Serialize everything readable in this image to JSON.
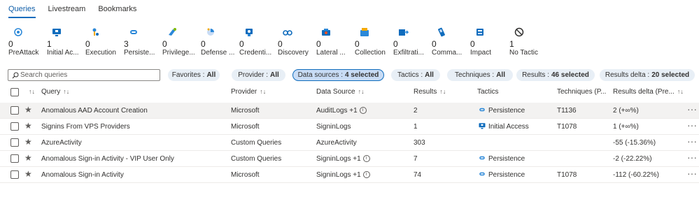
{
  "tabs": [
    {
      "label": "Queries",
      "active": true
    },
    {
      "label": "Livestream",
      "active": false
    },
    {
      "label": "Bookmarks",
      "active": false
    }
  ],
  "tactics": [
    {
      "icon": "preattack-icon",
      "count": "0",
      "name": "PreAttack"
    },
    {
      "icon": "initial-access-icon",
      "count": "1",
      "name": "Initial Ac..."
    },
    {
      "icon": "execution-icon",
      "count": "0",
      "name": "Execution"
    },
    {
      "icon": "persistence-icon",
      "count": "3",
      "name": "Persiste..."
    },
    {
      "icon": "privilege-escalation-icon",
      "count": "0",
      "name": "Privilege..."
    },
    {
      "icon": "defense-evasion-icon",
      "count": "0",
      "name": "Defense ..."
    },
    {
      "icon": "credential-access-icon",
      "count": "0",
      "name": "Credenti..."
    },
    {
      "icon": "discovery-icon",
      "count": "0",
      "name": "Discovery"
    },
    {
      "icon": "lateral-movement-icon",
      "count": "0",
      "name": "Lateral ..."
    },
    {
      "icon": "collection-icon",
      "count": "0",
      "name": "Collection"
    },
    {
      "icon": "exfiltration-icon",
      "count": "0",
      "name": "Exfiltrati..."
    },
    {
      "icon": "command-control-icon",
      "count": "0",
      "name": "Comma..."
    },
    {
      "icon": "impact-icon",
      "count": "0",
      "name": "Impact"
    },
    {
      "icon": "no-tactic-icon",
      "count": "1",
      "name": "No Tactic"
    }
  ],
  "search": {
    "placeholder": "Search queries"
  },
  "filters": [
    {
      "key": "Favorites :",
      "value": "All"
    },
    {
      "key": "Provider :",
      "value": "All"
    },
    {
      "key": "Data sources :",
      "value": "4 selected",
      "selected": true
    },
    {
      "key": "Tactics :",
      "value": "All"
    },
    {
      "key": "Techniques :",
      "value": "All"
    },
    {
      "key": "Results :",
      "value": "46 selected"
    },
    {
      "key": "Results delta :",
      "value": "20 selected"
    }
  ],
  "columns": {
    "query": "Query",
    "provider": "Provider",
    "datasource": "Data Source",
    "results": "Results",
    "tactics": "Tactics",
    "techniques": "Techniques (P...",
    "delta": "Results delta (Pre..."
  },
  "rows": [
    {
      "query": "Anomalous AAD Account Creation",
      "provider": "Microsoft",
      "datasource": "AuditLogs +1",
      "info": true,
      "results": "2",
      "tactic": "Persistence",
      "tactic_icon": "persistence-icon",
      "technique": "T1136",
      "delta": "2 (+∞%)",
      "highlight": true
    },
    {
      "query": "Signins From VPS Providers",
      "provider": "Microsoft",
      "datasource": "SigninLogs",
      "info": false,
      "results": "1",
      "tactic": "Initial Access",
      "tactic_icon": "initial-access-icon",
      "technique": "T1078",
      "delta": "1 (+∞%)",
      "highlight": false
    },
    {
      "query": "AzureActivity",
      "provider": "Custom Queries",
      "datasource": "AzureActivity",
      "info": false,
      "results": "303",
      "tactic": "",
      "tactic_icon": "",
      "technique": "",
      "delta": "-55 (-15.36%)",
      "highlight": false
    },
    {
      "query": "Anomalous Sign-in Activity - VIP User Only",
      "provider": "Custom Queries",
      "datasource": "SigninLogs +1",
      "info": true,
      "results": "7",
      "tactic": "Persistence",
      "tactic_icon": "persistence-icon",
      "technique": "",
      "delta": "-2 (-22.22%)",
      "highlight": false
    },
    {
      "query": "Anomalous Sign-in Activity",
      "provider": "Microsoft",
      "datasource": "SigninLogs +1",
      "info": true,
      "results": "74",
      "tactic": "Persistence",
      "tactic_icon": "persistence-icon",
      "technique": "T1078",
      "delta": "-112 (-60.22%)",
      "highlight": false
    }
  ],
  "colors": {
    "accent": "#0f6cbd",
    "pill": "#e8eff6",
    "row_highlight": "#f3f2f1"
  }
}
